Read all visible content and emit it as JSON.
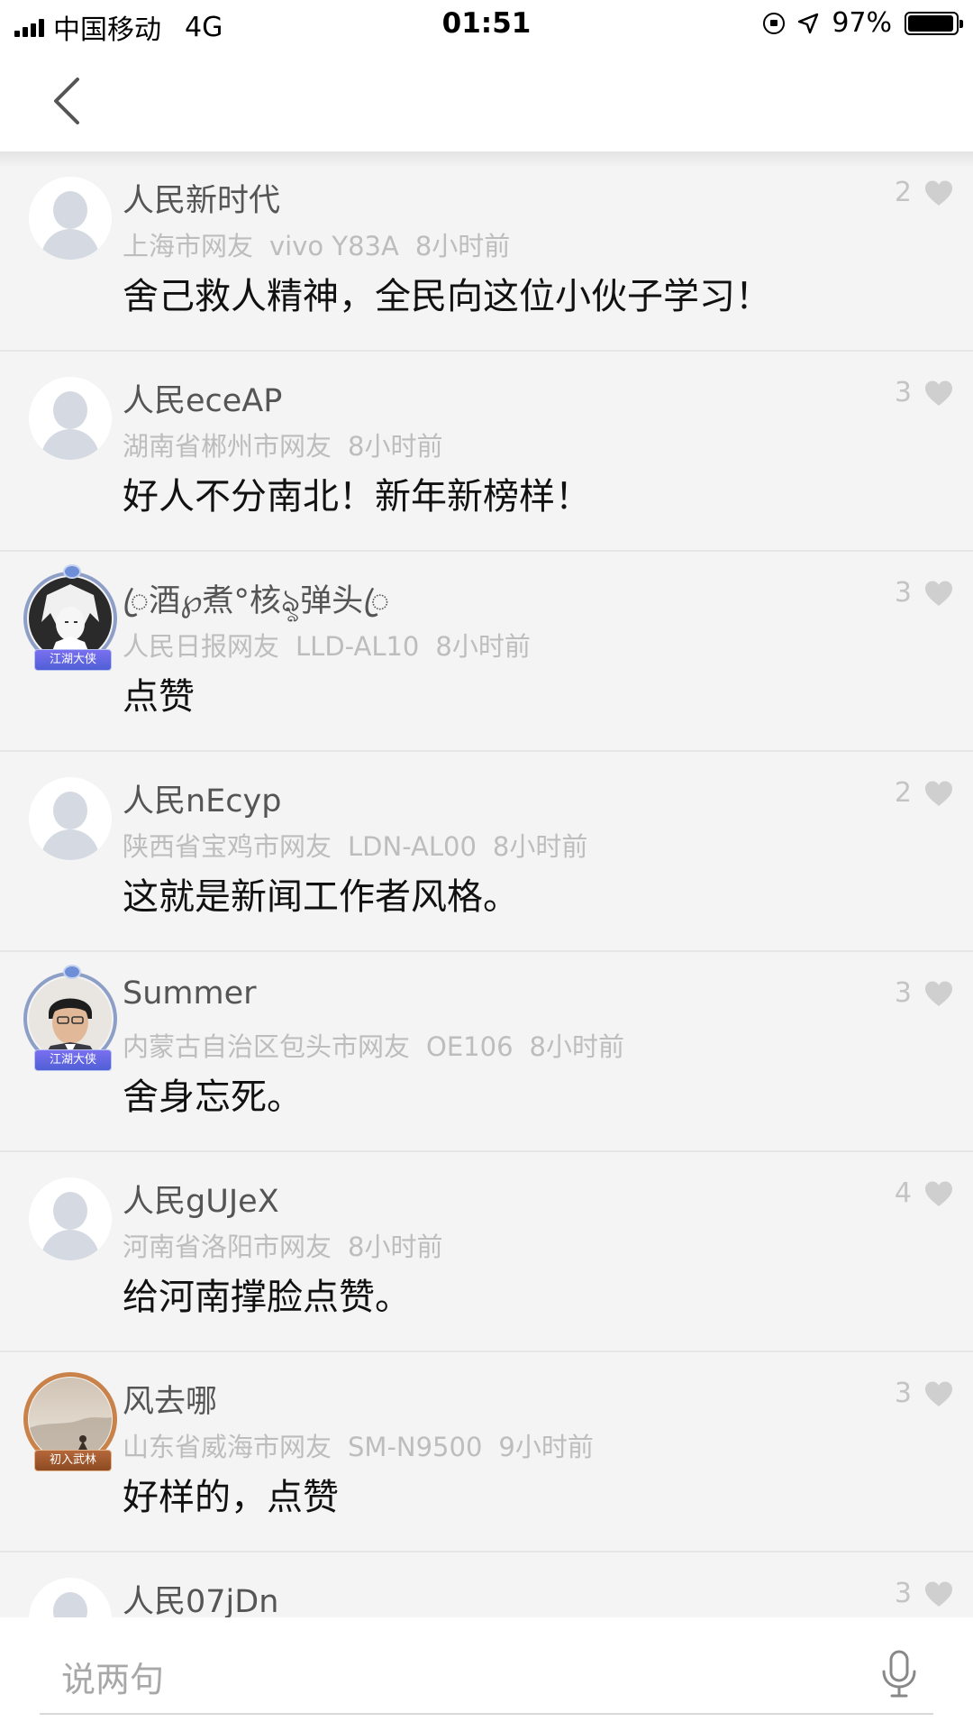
{
  "status_bar": {
    "carrier": "中国移动",
    "network": "4G",
    "time": "01:51",
    "battery": "97%",
    "battery_level": 0.97
  },
  "nav": {
    "back_icon": "chevron-left-icon"
  },
  "comments": [
    {
      "name": "人民新时代",
      "region": "上海市网友",
      "device": "vivo Y83A",
      "time": "8小时前",
      "text": "舍己救人精神，全民向这位小伙子学习！",
      "likes": "2"
    },
    {
      "name": "人民eceAP",
      "region": "湖南省郴州市网友",
      "device": "",
      "time": "8小时前",
      "text": "好人不分南北！新年新榜样！",
      "likes": "3"
    },
    {
      "name": "ꦿ酒℘煮°核ৡ弹头ꦿ",
      "region": "人民日报网友",
      "device": "LLD-AL10",
      "time": "8小时前",
      "text": "点赞",
      "likes": "3",
      "badge": "江湖大侠"
    },
    {
      "name": "人民nEcyp",
      "region": "陕西省宝鸡市网友",
      "device": "LDN-AL00",
      "time": "8小时前",
      "text": "这就是新闻工作者风格。",
      "likes": "2"
    },
    {
      "name": "Summer",
      "region": "内蒙古自治区包头市网友",
      "device": "OE106",
      "time": "8小时前",
      "text": "舍身忘死。",
      "likes": "3",
      "badge": "江湖大侠"
    },
    {
      "name": "人民gUJeX",
      "region": "河南省洛阳市网友",
      "device": "",
      "time": "8小时前",
      "text": "给河南撑脸点赞。",
      "likes": "4"
    },
    {
      "name": "风去哪",
      "region": "山东省威海市网友",
      "device": "SM-N9500",
      "time": "9小时前",
      "text": "好样的，点赞",
      "likes": "3",
      "badge": "初入武林"
    },
    {
      "name": "人民07jDn",
      "likes": "3"
    }
  ],
  "input": {
    "placeholder": "说两句"
  }
}
